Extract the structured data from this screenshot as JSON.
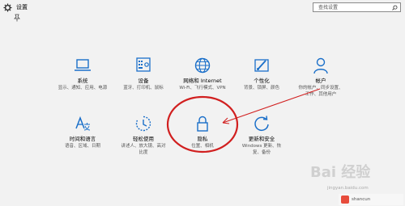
{
  "window": {
    "title": "设置"
  },
  "search": {
    "placeholder": "查找设置"
  },
  "tiles": [
    {
      "id": "system",
      "name": "系统",
      "desc": [
        "显示、通知、应用、电源"
      ]
    },
    {
      "id": "devices",
      "name": "设备",
      "desc": [
        "蓝牙、打印机、鼠标"
      ]
    },
    {
      "id": "network",
      "name": "网络和 Internet",
      "desc": [
        "Wi-Fi、飞行模式、VPN"
      ]
    },
    {
      "id": "personalization",
      "name": "个性化",
      "desc": [
        "背景、锁屏、颜色"
      ]
    },
    {
      "id": "accounts",
      "name": "帐户",
      "desc": [
        "你的帐户、同步设置、",
        "工作、其他用户"
      ]
    },
    {
      "id": "time-language",
      "name": "时间和语言",
      "desc": [
        "语音、区域、日期"
      ]
    },
    {
      "id": "ease-of-access",
      "name": "轻松使用",
      "desc": [
        "讲述人、放大镜、高对",
        "比度"
      ]
    },
    {
      "id": "privacy",
      "name": "隐私",
      "desc": [
        "位置、相机"
      ]
    },
    {
      "id": "update-security",
      "name": "更新和安全",
      "desc": [
        "Windows 更新、恢",
        "复、备份"
      ]
    }
  ],
  "colors": {
    "accent": "#1a6fc9",
    "annotation": "#d11f1f",
    "background": "#f2f2f2"
  },
  "watermark": {
    "brand": "Bai 经验",
    "domain": "jingyan.baidu.com",
    "footer": "shancun"
  }
}
